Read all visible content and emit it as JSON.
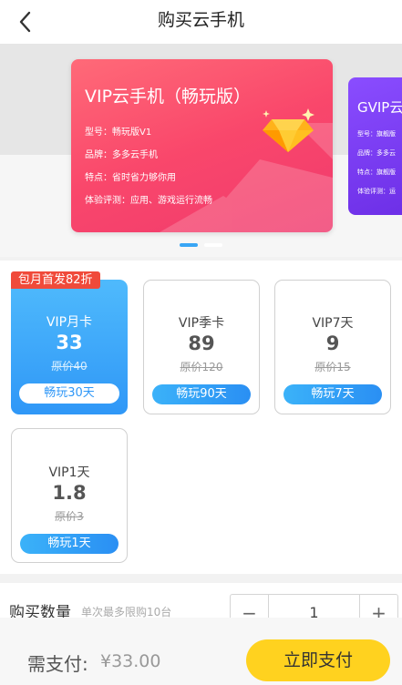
{
  "header": {
    "title": "购买云手机"
  },
  "carousel": {
    "main_card": {
      "name": "VIP云手机（畅玩版）",
      "lines": [
        "型号：畅玩版V1",
        "品牌：多多云手机",
        "特点：省时省力够你用",
        "体验评测：应用、游戏运行流畅"
      ]
    },
    "next_card": {
      "name": "GVIP云",
      "lines": [
        "型号：旗舰版",
        "品牌：多多云",
        "特点：旗舰版",
        "体验评测：运"
      ]
    },
    "active_index": 0,
    "slide_count": 2
  },
  "packages": {
    "badge": "包月首发82折",
    "items": [
      {
        "name": "VIP月卡",
        "price": "33",
        "original": "原价40",
        "button": "畅玩30天",
        "selected": true
      },
      {
        "name": "VIP季卡",
        "price": "89",
        "original": "原价120",
        "button": "畅玩90天",
        "selected": false
      },
      {
        "name": "VIP7天",
        "price": "9",
        "original": "原价15",
        "button": "畅玩7天",
        "selected": false
      },
      {
        "name": "VIP1天",
        "price": "1.8",
        "original": "原价3",
        "button": "畅玩1天",
        "selected": false
      }
    ]
  },
  "quantity": {
    "label": "购买数量",
    "hint": "单次最多限购10台",
    "minus": "−",
    "value": "1",
    "plus": "+"
  },
  "bottom": {
    "pay_label": "需支付:",
    "pay_amount": "¥33.00",
    "pay_button": "立即支付"
  },
  "colors": {
    "accent_blue": "#2f97f7",
    "pay_yellow": "#ffd21f",
    "badge_red": "#f04a3a",
    "vip_card_pink": "#f9476b",
    "gvip_card_purple": "#6c2ee6"
  }
}
